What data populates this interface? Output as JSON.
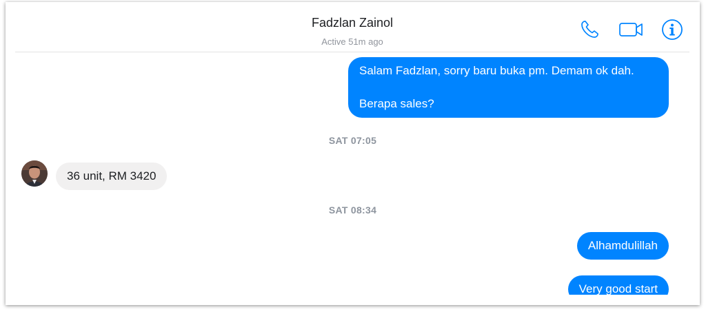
{
  "header": {
    "contact_name": "Fadzlan Zainol",
    "status": "Active 51m ago",
    "icons": [
      "phone-icon",
      "video-camera-icon",
      "info-icon"
    ]
  },
  "messages": {
    "msg1_line1": "Salam Fadzlan, sorry baru buka pm. Demam ok dah.",
    "msg1_line2": "Berapa sales?",
    "timestamp1": "SAT 07:05",
    "msg2": "36 unit, RM 3420",
    "timestamp2": "SAT 08:34",
    "msg3": "Alhamdulillah",
    "msg4": "Very good start"
  },
  "colors": {
    "accent": "#0084ff",
    "incoming_bubble": "#f1f0f0",
    "timestamp": "#8d949e"
  }
}
